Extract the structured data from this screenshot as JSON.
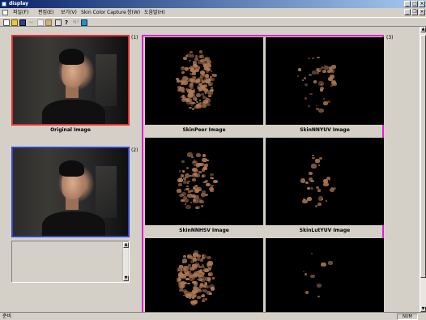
{
  "window": {
    "title": "display"
  },
  "menu": {
    "items": [
      {
        "id": "file",
        "label": "파일(F)"
      },
      {
        "id": "edit",
        "label": "편집(E)"
      },
      {
        "id": "view",
        "label": "보기(V)"
      },
      {
        "id": "skin-color",
        "label": "Skin Color"
      },
      {
        "id": "capture",
        "label": "Capture"
      },
      {
        "id": "window",
        "label": "창(W)"
      },
      {
        "id": "help",
        "label": "도움말(H)"
      }
    ]
  },
  "toolbar": {
    "icons": [
      "new-document-icon",
      "open-folder-icon",
      "save-disk-icon",
      "cut-icon",
      "copy-icon",
      "paste-icon",
      "print-icon",
      "help-icon",
      "about-icon",
      "capture-picture-icon"
    ]
  },
  "left": {
    "original_label": "Original Image",
    "panel1_num": "(1)",
    "panel2_num": "(2)"
  },
  "right": {
    "group_num": "(3)",
    "images": [
      {
        "label": "SkinPeer Image",
        "density": 0.85
      },
      {
        "label": "SkinNNYUV Image",
        "density": 0.35
      },
      {
        "label": "SkinNNHSV Image",
        "density": 0.6
      },
      {
        "label": "SkinLutYUV Image",
        "density": 0.3
      },
      {
        "label": "",
        "density": 0.8
      },
      {
        "label": "",
        "density": 0.1
      }
    ]
  },
  "status": {
    "text": "준비",
    "num": "NUM"
  },
  "colors": {
    "original_border": "#e03030",
    "second_border": "#3048c8",
    "group_border": "#e020d0",
    "skin_tone": "#b07a55"
  }
}
